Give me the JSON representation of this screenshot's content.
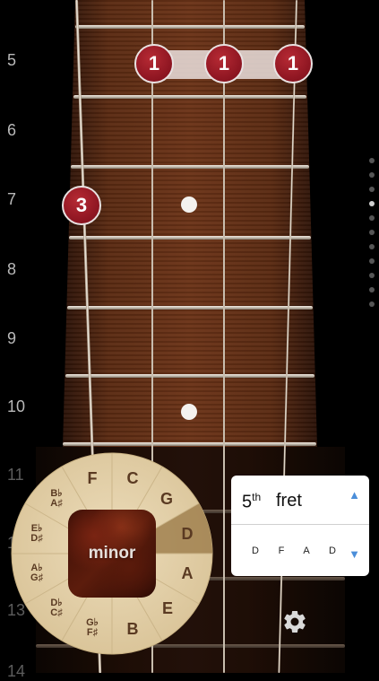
{
  "fret_numbers": [
    "5",
    "6",
    "7",
    "8",
    "9",
    "10",
    "11",
    "12",
    "13",
    "14"
  ],
  "finger_markers": [
    "1",
    "1",
    "1",
    "3"
  ],
  "chord_wheel": {
    "notes": [
      "C",
      "G",
      "D",
      "A",
      "E",
      "B",
      "G♭\nF♯",
      "D♭\nC♯",
      "A♭\nG♯",
      "E♭\nD♯",
      "B♭\nA♯",
      "F"
    ],
    "selected": "D",
    "mode_label": "minor"
  },
  "fret_selector": {
    "number": "5",
    "suffix": "th",
    "word": "fret",
    "up_arrow": "▲",
    "down_arrow": "▼",
    "notes": [
      "D",
      "F",
      "A",
      "D"
    ]
  },
  "colors": {
    "finger_red": "#8f1622",
    "accent_blue": "#4b8ed9",
    "wheel_wood": "#e3cfa6",
    "selected_sector": "#9c7c4a"
  },
  "icons": {
    "settings": "gear-icon"
  }
}
